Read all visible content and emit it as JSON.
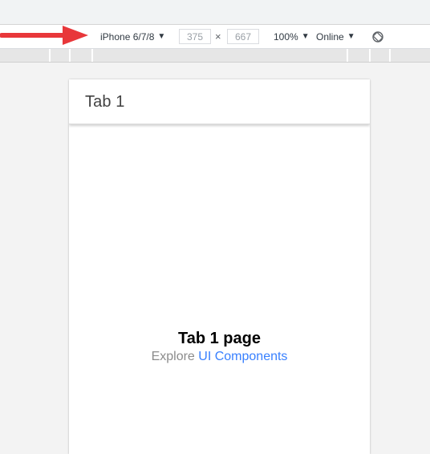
{
  "devtools": {
    "device_label": "iPhone 6/7/8",
    "width_value": "375",
    "height_value": "667",
    "dimension_separator": "×",
    "zoom_label": "100%",
    "network_label": "Online",
    "caret_glyph": "▼"
  },
  "app": {
    "header_title": "Tab 1",
    "page_heading": "Tab 1 page",
    "explore_prefix": "Explore ",
    "explore_link": "UI Components"
  },
  "colors": {
    "annotation_arrow": "#e8373a",
    "link": "#3880ff"
  }
}
